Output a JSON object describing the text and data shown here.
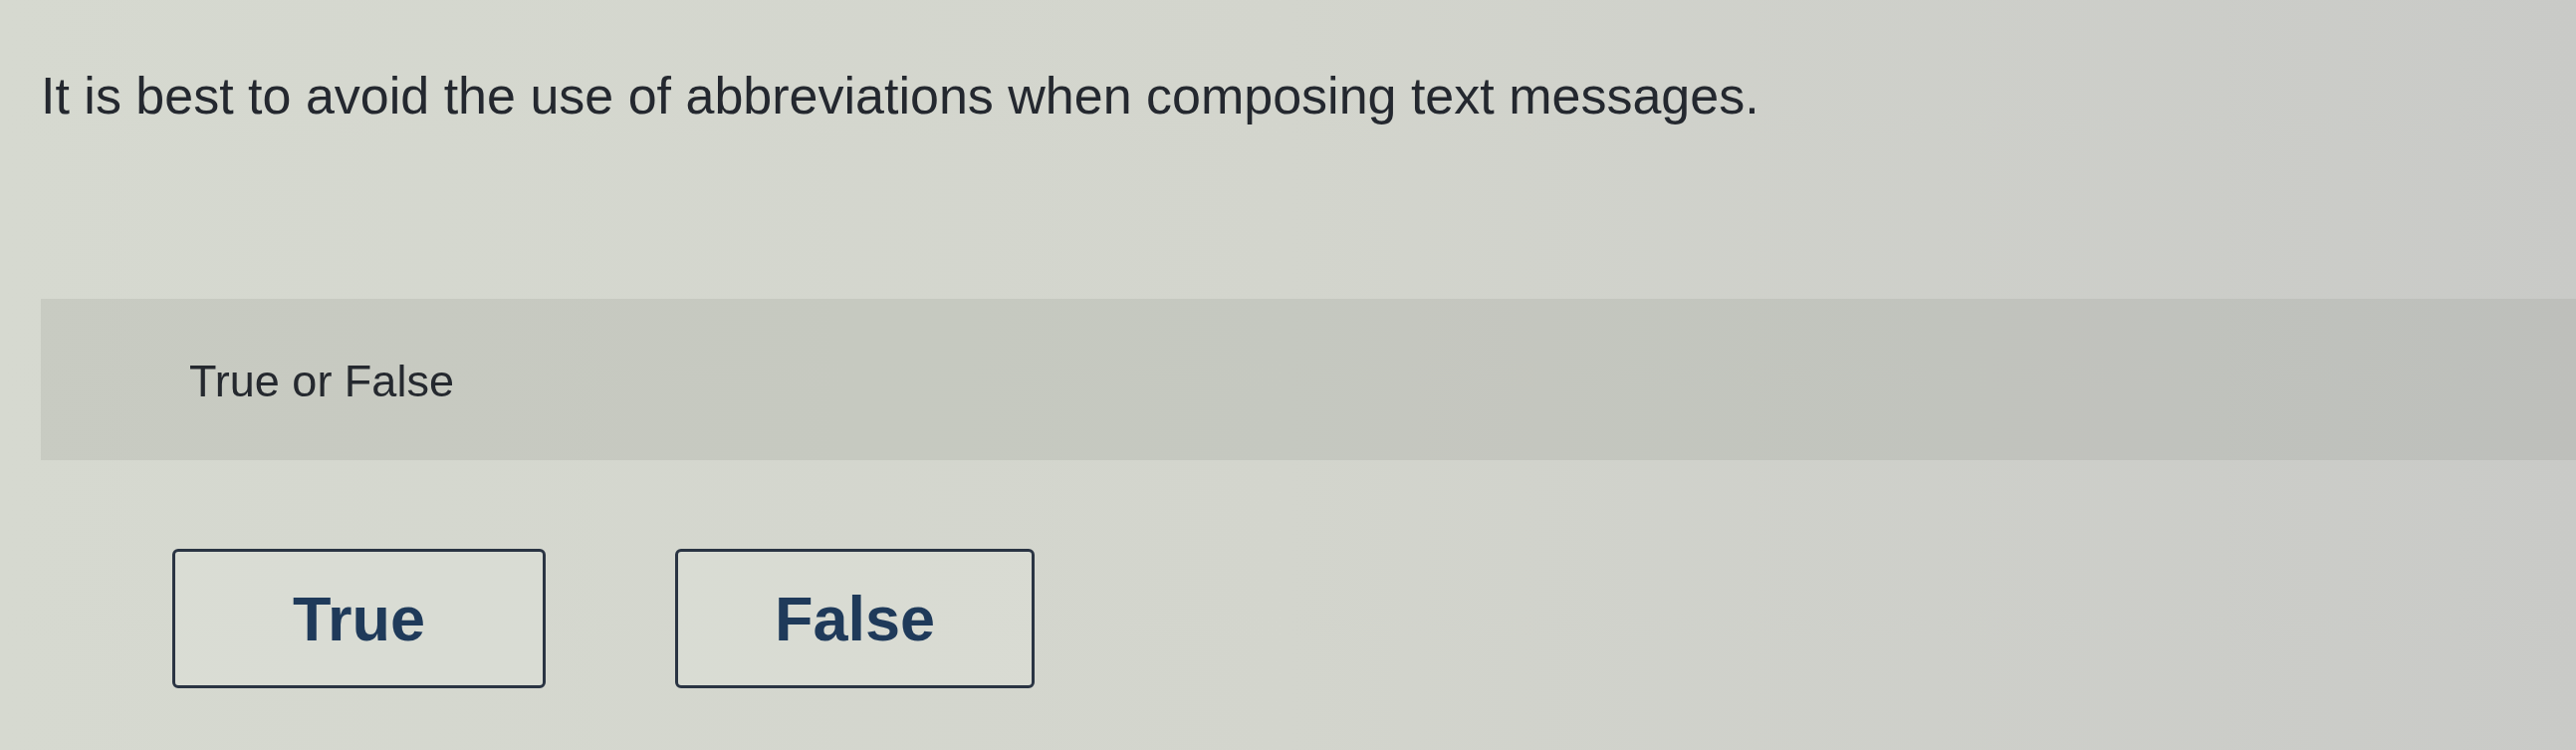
{
  "question": {
    "text": "It is best to avoid the use of abbreviations when composing text messages."
  },
  "answer_area": {
    "prompt": "True or False"
  },
  "options": [
    {
      "label": "True",
      "selected": false
    },
    {
      "label": "False",
      "selected": false
    }
  ]
}
